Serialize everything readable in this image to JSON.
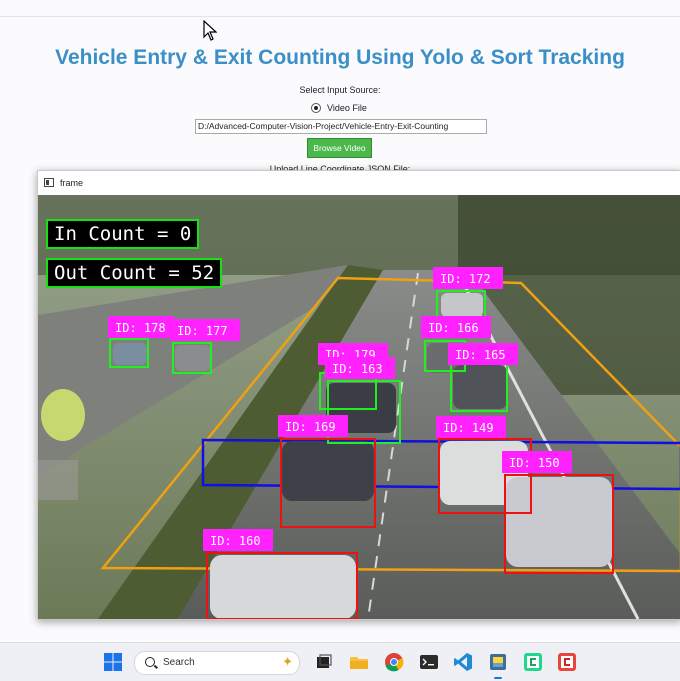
{
  "app": {
    "title": "Vehicle Entry & Exit Counting Using Yolo & Sort Tracking",
    "select_source_label": "Select Input Source:",
    "source_option": "Video File",
    "file_path": "D:/Advanced-Computer-Vision-Project/Vehicle-Entry-Exit-Counting",
    "browse_label": "Browse Video",
    "upload_label": "Upload Line Coordinate JSON File:"
  },
  "frame_window": {
    "title": "frame",
    "in_count": "In Count = 0",
    "out_count": "Out Count = 52",
    "detections": [
      {
        "id": "ID: 172",
        "color": "green"
      },
      {
        "id": "ID: 178",
        "color": "green"
      },
      {
        "id": "ID: 177",
        "color": "green"
      },
      {
        "id": "ID: 166",
        "color": "green"
      },
      {
        "id": "ID: 179",
        "color": "green"
      },
      {
        "id": "ID: 165",
        "color": "green"
      },
      {
        "id": "ID: 163",
        "color": "green"
      },
      {
        "id": "ID: 169",
        "color": "red"
      },
      {
        "id": "ID: 149",
        "color": "red"
      },
      {
        "id": "ID: 150",
        "color": "red"
      },
      {
        "id": "ID: 160",
        "color": "red"
      }
    ]
  },
  "colors": {
    "title": "#3a8fc8",
    "label_bg": "#ff22ff",
    "box_green": "#22ee22",
    "box_red": "#ee1111",
    "roi_orange": "#f0a010",
    "count_line_blue": "#1010e0",
    "browse_button": "#4cb84c"
  },
  "taskbar": {
    "search_placeholder": "Search",
    "icons": [
      "windows-start-icon",
      "search-icon",
      "task-view-icon",
      "file-explorer-icon",
      "chrome-icon",
      "terminal-icon",
      "vscode-icon",
      "python-app-icon",
      "pycharm-green-icon",
      "pycharm-red-icon"
    ]
  }
}
